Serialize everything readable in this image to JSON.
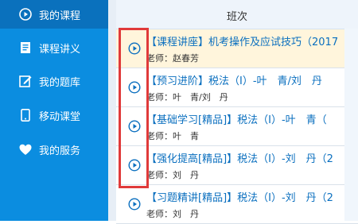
{
  "sidebar": {
    "items": [
      {
        "label": "我的课程",
        "icon": "play-circle-icon",
        "active": true
      },
      {
        "label": "课程讲义",
        "icon": "document-icon",
        "active": false
      },
      {
        "label": "我的题库",
        "icon": "edit-icon",
        "active": false
      },
      {
        "label": "移动课堂",
        "icon": "mobile-icon",
        "active": false
      },
      {
        "label": "我的服务",
        "icon": "heart-icon",
        "active": false
      }
    ]
  },
  "table": {
    "header": "班次",
    "rows": [
      {
        "title": "【课程讲座】机考操作及应试技巧（2017",
        "teacher": "老师：赵春芳"
      },
      {
        "title": "【预习进阶】税法（Ⅰ）-叶　青/刘　丹",
        "teacher": "老师：叶　青/刘　丹"
      },
      {
        "title": "【基础学习[精品]】税法（Ⅰ）-叶　青（",
        "teacher": "老师：叶　青"
      },
      {
        "title": "【强化提高[精品]】税法（Ⅰ）-刘　丹（2",
        "teacher": "老师：刘　丹"
      },
      {
        "title": "【习题精讲[精品]】税法（Ⅰ）-刘　丹（2",
        "teacher": "老师：刘　丹"
      }
    ]
  },
  "colors": {
    "sidebar": "#0b8de0",
    "sidebar_active": "#0a71bd",
    "link": "#0a6fbf",
    "highlight_row": "#fff5dc",
    "annotation_box": "#e03a3a"
  }
}
